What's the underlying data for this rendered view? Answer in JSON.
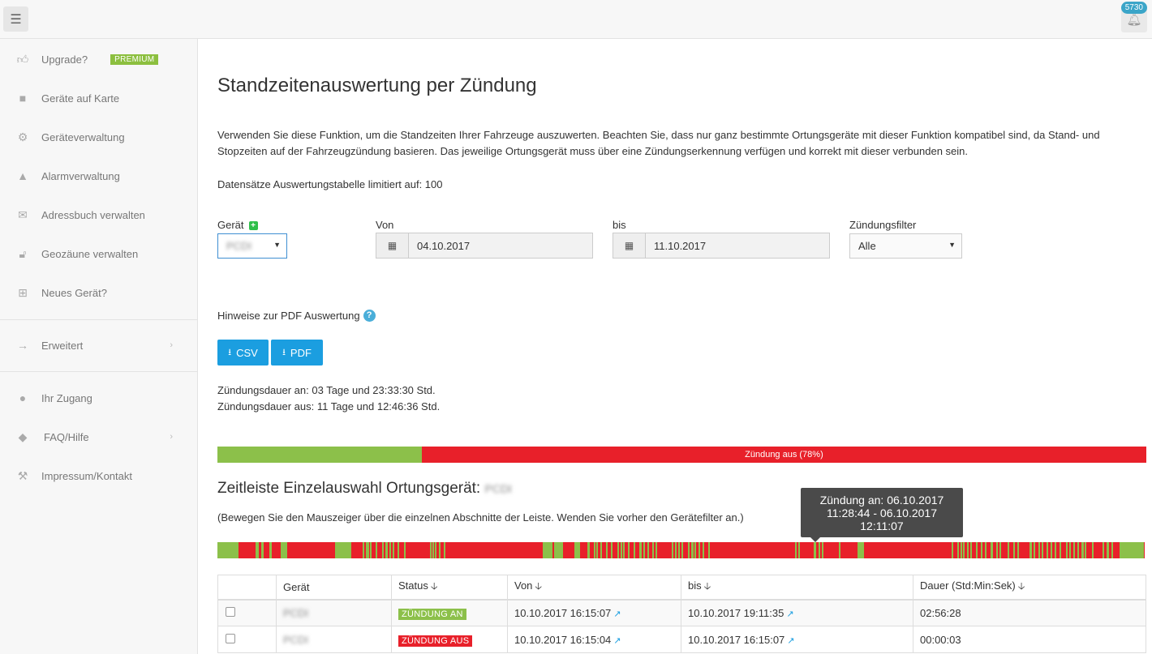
{
  "topbar": {
    "notification_count": "5730",
    "menu_icon": "hamburger-icon",
    "bell_icon": "bell-icon"
  },
  "sidebar": {
    "items": [
      {
        "label": "Upgrade?",
        "icon": "thumbs-up-icon",
        "badge": "PREMIUM"
      },
      {
        "label": "Geräte auf Karte",
        "icon": "truck-icon"
      },
      {
        "label": "Geräteverwaltung",
        "icon": "gears-icon"
      },
      {
        "label": "Alarmverwaltung",
        "icon": "warning-icon"
      },
      {
        "label": "Adressbuch verwalten",
        "icon": "envelope-icon"
      },
      {
        "label": "Geozäune verwalten",
        "icon": "unlock-icon"
      },
      {
        "label": "Neues Gerät?",
        "icon": "plus-square-icon"
      },
      {
        "label": "Erweitert",
        "icon": "arrow-right-icon"
      },
      {
        "label": "Ihr Zugang",
        "icon": "user-icon"
      },
      {
        "label": "FAQ/Hilfe",
        "icon": "graduation-cap-icon"
      },
      {
        "label": "Impressum/Kontakt",
        "icon": "gavel-icon"
      }
    ]
  },
  "page": {
    "title": "Standzeitenauswertung per Zündung",
    "description": "Verwenden Sie diese Funktion, um die Standzeiten Ihrer Fahrzeuge auszuwerten. Beachten Sie, dass nur ganz bestimmte Ortungsgeräte mit dieser Funktion kompatibel sind, da Stand- und Stopzeiten auf der Fahrzeugzündung basieren. Das jeweilige Ortungsgerät muss über eine Zündungserkennung verfügen und korrekt mit dieser verbunden sein.",
    "limit_note": "Datensätze Auswertungstabelle limitiert auf: 100"
  },
  "filters": {
    "device_label": "Gerät",
    "device_value": "PCDI",
    "from_label": "Von",
    "from_value": "04.10.2017",
    "to_label": "bis",
    "to_value": "11.10.2017",
    "ignition_label": "Zündungsfilter",
    "ignition_value": "Alle"
  },
  "export": {
    "hint": "Hinweise zur PDF Auswertung",
    "csv_label": "CSV",
    "pdf_label": "PDF"
  },
  "summary": {
    "on_duration": "Zündungsdauer an: 03 Tage und 23:33:30 Std.",
    "off_duration": "Zündungsdauer aus: 11 Tage und 12:46:36 Std.",
    "off_bar_label": "Zündung aus (78%)",
    "on_fraction": 0.22,
    "on_color": "#8cc04a",
    "off_color": "#e8202a"
  },
  "timeline": {
    "title": "Zeitleiste Einzelauswahl Ortungsgerät:",
    "device": "PCDI",
    "note": "(Bewegen Sie den Mauszeiger über die einzelnen Abschnitte der Leiste. Wenden Sie vorher den Gerätefilter an.)",
    "tooltip_line1": "Zündung an: 06.10.2017",
    "tooltip_line2": "11:28:44 - 06.10.2017",
    "tooltip_line3": "12:11:07"
  },
  "table": {
    "headers": [
      "",
      "Gerät",
      "Status",
      "Von",
      "bis",
      "Dauer (Std:Min:Sek)"
    ],
    "rows": [
      {
        "device": "PCDI",
        "status": "ZÜNDUNG AN",
        "from": "10.10.2017 16:15:07",
        "to": "10.10.2017 19:11:35",
        "duration": "02:56:28"
      },
      {
        "device": "PCDI",
        "status": "ZÜNDUNG AUS",
        "from": "10.10.2017 16:15:04",
        "to": "10.10.2017 16:15:07",
        "duration": "00:00:03"
      }
    ]
  }
}
